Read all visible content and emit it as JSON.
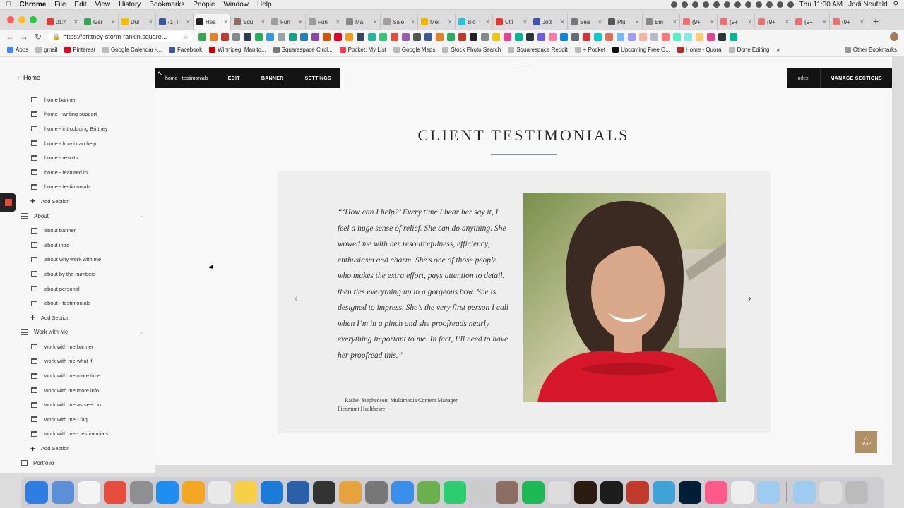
{
  "menubar": {
    "app": "Chrome",
    "items": [
      "File",
      "Edit",
      "View",
      "History",
      "Bookmarks",
      "People",
      "Window",
      "Help"
    ],
    "clock": "Thu 11:30 AM",
    "user": "Jodi Neufeld"
  },
  "tabs": [
    {
      "label": "01:4",
      "color": "#e53935"
    },
    {
      "label": "Ger",
      "color": "#34a853"
    },
    {
      "label": "Dul",
      "color": "#fbbc05"
    },
    {
      "label": "(1) I",
      "color": "#3b5998"
    },
    {
      "label": "Hea",
      "color": "#222222",
      "active": true
    },
    {
      "label": "Squ",
      "color": "#8d6e63"
    },
    {
      "label": "Fun",
      "color": "#9e9e9e"
    },
    {
      "label": "Fun",
      "color": "#9e9e9e"
    },
    {
      "label": "Ma:",
      "color": "#888888"
    },
    {
      "label": "Sale",
      "color": "#9e9e9e"
    },
    {
      "label": "Mei",
      "color": "#f4b400"
    },
    {
      "label": "Blo",
      "color": "#26c6da"
    },
    {
      "label": "Ulti",
      "color": "#e53935"
    },
    {
      "label": "Jod",
      "color": "#3f51b5"
    },
    {
      "label": "Sea",
      "color": "#777777"
    },
    {
      "label": "Plu",
      "color": "#555555"
    },
    {
      "label": "Em",
      "color": "#888888"
    },
    {
      "label": "(9+",
      "color": "#e57373"
    },
    {
      "label": "(9+",
      "color": "#e57373"
    },
    {
      "label": "(9+",
      "color": "#e57373"
    },
    {
      "label": "(9+",
      "color": "#e57373"
    },
    {
      "label": "(9+",
      "color": "#e57373"
    }
  ],
  "address": {
    "url": "https://brittney-storm-rankin.square..."
  },
  "bookmarks": [
    {
      "label": "Apps",
      "color": "#4285f4"
    },
    {
      "label": "gmail",
      "color": "#bbbbbb"
    },
    {
      "label": "Pinterest",
      "color": "#e60023"
    },
    {
      "label": "Google Calendar -...",
      "color": "#bbbbbb"
    },
    {
      "label": "Facebook",
      "color": "#3b5998"
    },
    {
      "label": "Winnipeg, Manito...",
      "color": "#cc0000"
    },
    {
      "label": "Squarespace Circl...",
      "color": "#777777"
    },
    {
      "label": "Pocket: My List",
      "color": "#ef4056"
    },
    {
      "label": "Google Maps",
      "color": "#bbbbbb"
    },
    {
      "label": "Stock Photo Search",
      "color": "#bbbbbb"
    },
    {
      "label": "Squarespace Reddit",
      "color": "#bbbbbb"
    },
    {
      "label": "+ Pocket",
      "color": "#bbbbbb"
    },
    {
      "label": "Upcoming Free O...",
      "color": "#111111"
    },
    {
      "label": "Home - Quora",
      "color": "#b92b27"
    },
    {
      "label": "Done Editing",
      "color": "#bbbbbb"
    }
  ],
  "bookmarks_more": "»",
  "bookmarks_other": "Other Bookmarks",
  "sidebar": {
    "home_label": "Home",
    "rows": [
      {
        "kind": "child",
        "label": "home banner"
      },
      {
        "kind": "child",
        "label": "home - writing support"
      },
      {
        "kind": "child",
        "label": "home - introducing Brittney"
      },
      {
        "kind": "child",
        "label": "home - how i can help"
      },
      {
        "kind": "child",
        "label": "home - results"
      },
      {
        "kind": "child",
        "label": "home - featured in"
      },
      {
        "kind": "child",
        "label": "home - testimonials"
      },
      {
        "kind": "add",
        "label": "Add Section"
      },
      {
        "kind": "group",
        "label": "About"
      },
      {
        "kind": "child",
        "label": "about banner"
      },
      {
        "kind": "child",
        "label": "about intro"
      },
      {
        "kind": "child",
        "label": "about why work with me"
      },
      {
        "kind": "child",
        "label": "about by the numbers"
      },
      {
        "kind": "child",
        "label": "about personal"
      },
      {
        "kind": "child",
        "label": "about - testimonials"
      },
      {
        "kind": "add",
        "label": "Add Section"
      },
      {
        "kind": "group",
        "label": "Work with Me"
      },
      {
        "kind": "child",
        "label": "work with me banner"
      },
      {
        "kind": "child",
        "label": "work with me what if"
      },
      {
        "kind": "child",
        "label": "work with me more time"
      },
      {
        "kind": "child",
        "label": "work with me more info"
      },
      {
        "kind": "child",
        "label": "work with me as seen in"
      },
      {
        "kind": "child",
        "label": "work with me - faq"
      },
      {
        "kind": "child",
        "label": "work with me - testimonials"
      },
      {
        "kind": "add",
        "label": "Add Section"
      },
      {
        "kind": "top",
        "label": "Portfolio"
      }
    ]
  },
  "editbar": {
    "crumb": "home - testimonials",
    "buttons": [
      "EDIT",
      "BANNER",
      "SETTINGS"
    ],
    "index": "Index",
    "manage": "MANAGE SECTIONS"
  },
  "section": {
    "title": "CLIENT TESTIMONIALS",
    "quote": "“‘How can I help?’ Every time I hear her say it, I feel a huge sense of relief. She can do anything. She wowed me with her resourcefulness, efficiency, enthusiasm and charm. She’s one of those people who makes the extra effort, pays attention to detail, then ties everything up in a gorgeous bow. She is designed to impress. She’s the very first person I call when I’m in a pinch and she proofreads nearly everything important to me. In fact, I’ll need to have her proofread this.”",
    "cite_line1": "— Rashel Stephenson, Multimedia Content Manager",
    "cite_line2": "Piedmont Healthcare",
    "prev_arrow": "‹",
    "next_arrow": "›",
    "top_button": "TOP"
  },
  "colors": {
    "brand_gold": "#b09064",
    "editbar_bg": "#141414",
    "rule": "#8a95aa"
  },
  "dock_colors": [
    "#2e7de0",
    "#5b8fd6",
    "#f4f4f4",
    "#e74c3c",
    "#8e8e93",
    "#1f8ef1",
    "#f5a623",
    "#e9e9e9",
    "#f7d046",
    "#1a7bd8",
    "#2b5fa8",
    "#333333",
    "#e6a23c",
    "#777777",
    "#3b8eea",
    "#6ab04c",
    "#2ecc71",
    "#cccccc",
    "#8d6e63",
    "#1db954",
    "#dddddd",
    "#2c1b10",
    "#1d1d1d",
    "#c0392b",
    "#3fa3d8",
    "#001e36",
    "#ff5a8a",
    "#eeeeee",
    "#9ecbf0",
    "#9ecbf0",
    "#dddddd",
    "#bbbbbb"
  ]
}
